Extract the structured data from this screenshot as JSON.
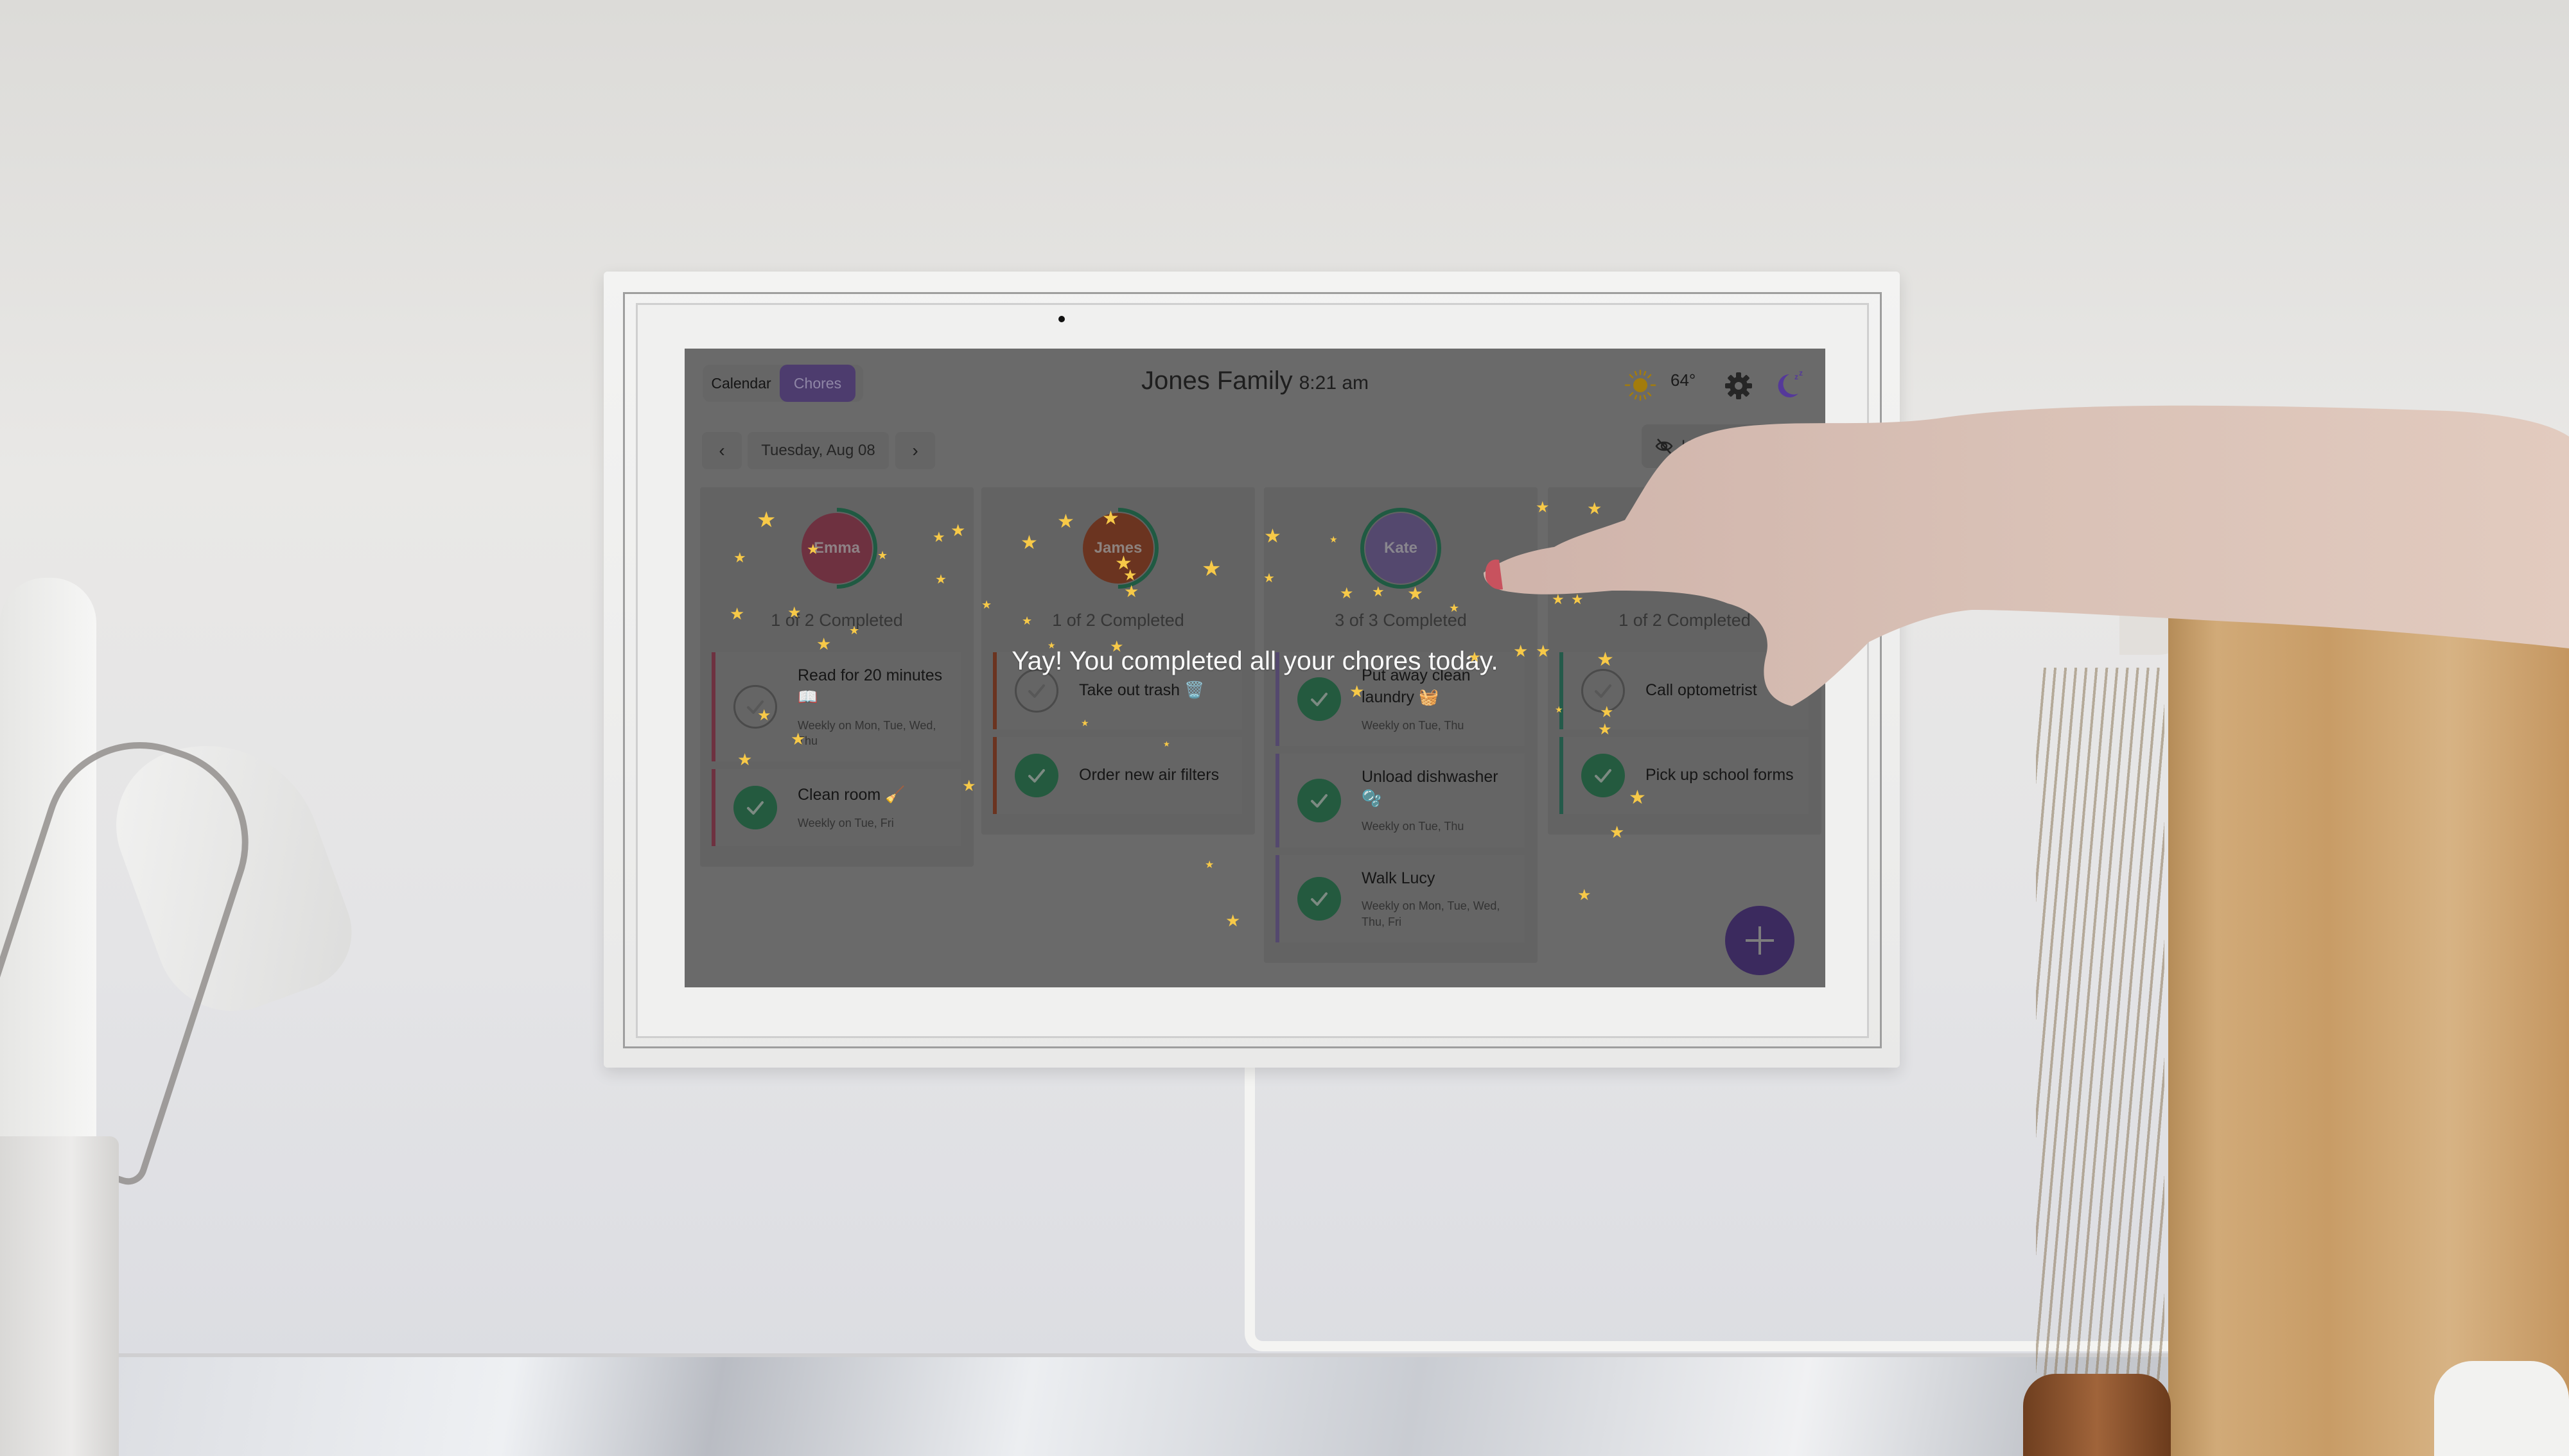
{
  "app": {
    "family_name": "Jones Family",
    "time": "8:21 am",
    "view_tabs": [
      {
        "label": "Calendar",
        "active": false
      },
      {
        "label": "Chores",
        "active": true
      }
    ],
    "weather": {
      "temperature": "64°",
      "icon": "sun-icon"
    },
    "settings_icon": "gear-icon",
    "sleep_icon": "moon-sleep-icon",
    "accent_color": "#4d3c6e"
  },
  "date_nav": {
    "prev_label": "‹",
    "date": "Tuesday, Aug 08",
    "next_label": "›"
  },
  "hide_button": {
    "label": "Hide",
    "icon": "eye-off-icon"
  },
  "celebration_message": "Yay! You completed all your chores today.",
  "add_button": {
    "label": "+",
    "icon": "plus-icon"
  },
  "members": [
    {
      "name": "Emma",
      "color": "#6e3140",
      "completed": 1,
      "total": 2,
      "progress_text": "1 of 2 Completed",
      "chores": [
        {
          "title": "Read for 20 minutes 📖",
          "schedule": "Weekly on Mon, Tue, Wed, Thu",
          "done": false
        },
        {
          "title": "Clean room 🧹",
          "schedule": "Weekly on Tue, Fri",
          "done": true
        }
      ]
    },
    {
      "name": "James",
      "color": "#6b3420",
      "completed": 1,
      "total": 2,
      "progress_text": "1 of 2 Completed",
      "chores": [
        {
          "title": "Take out trash 🗑️",
          "schedule": "",
          "done": false
        },
        {
          "title": "Order new air filters",
          "schedule": "",
          "done": true
        }
      ]
    },
    {
      "name": "Kate",
      "color": "#54486e",
      "completed": 3,
      "total": 3,
      "progress_text": "3 of 3 Completed",
      "chores": [
        {
          "title": "Put away clean laundry 🧺",
          "schedule": "Weekly on Tue, Thu",
          "done": true
        },
        {
          "title": "Unload dishwasher 🫧",
          "schedule": "Weekly on Tue, Thu",
          "done": true
        },
        {
          "title": "Walk Lucy",
          "schedule": "Weekly on Mon, Tue, Wed, Thu, Fri",
          "done": true
        }
      ]
    },
    {
      "name": "",
      "color": "#245a4a",
      "completed": 1,
      "total": 2,
      "progress_text": "1 of 2 Completed",
      "chores": [
        {
          "title": "Call optometrist",
          "schedule": "",
          "done": false
        },
        {
          "title": "Pick up school forms",
          "schedule": "",
          "done": true
        }
      ]
    }
  ]
}
